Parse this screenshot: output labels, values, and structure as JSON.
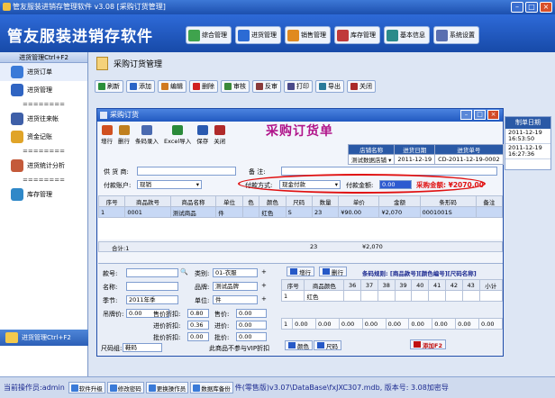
{
  "window": {
    "title": "管友服装进销存管理软件 v3.08 [采购订货管理]"
  },
  "banner": {
    "logo": "管友服装进销存软件"
  },
  "topnav": [
    {
      "label": "综合管理",
      "icon": "overview-icon",
      "color": "#3fa34d"
    },
    {
      "label": "进货管理",
      "icon": "purchase-icon",
      "color": "#2c6bd4"
    },
    {
      "label": "销售管理",
      "icon": "sales-icon",
      "color": "#e08a20"
    },
    {
      "label": "库存管理",
      "icon": "inventory-icon",
      "color": "#c03a3a"
    },
    {
      "label": "基本信息",
      "icon": "info-icon",
      "color": "#2a8a8a"
    },
    {
      "label": "系统设置",
      "icon": "settings-icon",
      "color": "#5a6fb0"
    }
  ],
  "sidebar": {
    "header": "进货管理Ctrl+F2",
    "items": [
      {
        "label": "进货订单",
        "icon": "order-icon",
        "color": "#3a7ad8",
        "type": "item"
      },
      {
        "label": "进货管理",
        "icon": "purchase-doc-icon",
        "color": "#2f64c2",
        "type": "item"
      },
      {
        "label": "========",
        "type": "dash"
      },
      {
        "label": "进货往来帐",
        "icon": "account-icon",
        "color": "#3e5fa8",
        "type": "item"
      },
      {
        "label": "资金记账",
        "icon": "coins-icon",
        "color": "#e0a428",
        "type": "item"
      },
      {
        "label": "========",
        "type": "dash"
      },
      {
        "label": "进货统计分析",
        "icon": "stats-icon",
        "color": "#c45a3a",
        "type": "item"
      },
      {
        "label": "========",
        "type": "dash"
      },
      {
        "label": "库存管理",
        "icon": "stock-icon",
        "color": "#2f88c8",
        "type": "item"
      }
    ],
    "footer": "进货管理Ctrl+F2"
  },
  "page": {
    "title": "采购订货管理"
  },
  "toolbar": [
    {
      "label": "刷新",
      "icon": "refresh-icon",
      "color": "#2a8f3a"
    },
    {
      "label": "添加",
      "icon": "add-icon",
      "color": "#2a64c6"
    },
    {
      "label": "编辑",
      "icon": "edit-icon",
      "color": "#d07a20"
    },
    {
      "label": "删除",
      "icon": "delete-icon",
      "color": "#d02020"
    },
    {
      "label": "审核",
      "icon": "approve-icon",
      "color": "#3a8a3a"
    },
    {
      "label": "反审",
      "icon": "unapprove-icon",
      "color": "#8a3a3a"
    },
    {
      "label": "打印",
      "icon": "print-icon",
      "color": "#4a4a8a"
    },
    {
      "label": "导出",
      "icon": "export-icon",
      "color": "#2a7a9a"
    },
    {
      "label": "关闭",
      "icon": "close-page-icon",
      "color": "#aa2a2a"
    }
  ],
  "bglist": {
    "header": "制单日期",
    "rows": [
      "2011-12-19 16:53:50",
      "2011-12-19 16:27:36"
    ]
  },
  "dialog": {
    "title": "采购订货",
    "toolbar": [
      {
        "label": "增行",
        "icon": "add-row-icon",
        "color": "#d05020"
      },
      {
        "label": "删行",
        "icon": "delete-row-icon",
        "color": "#c08020"
      },
      {
        "label": "条码录入",
        "icon": "barcode-icon",
        "color": "#4a6ab0"
      },
      {
        "label": "Excel导入",
        "icon": "excel-icon",
        "color": "#2a8a3a"
      },
      {
        "label": "保存",
        "icon": "save-icon",
        "color": "#2a5ab0"
      },
      {
        "label": "关闭",
        "icon": "close-icon",
        "color": "#b02a2a"
      }
    ],
    "big_title": "采购订货单",
    "header_table": {
      "cols": [
        "店铺名称",
        "进货日期",
        "进货单号"
      ],
      "values": [
        "测试数据店铺",
        "2011-12-19",
        "CD-2011-12-19-0002"
      ]
    },
    "supplier_label": "供 货 商:",
    "remark_label": "备  注:",
    "account_label": "付款账户:",
    "account_value": "现销",
    "paymethod_label": "付款方式:",
    "paymethod_value": "现金付款",
    "payamount_label": "付款金额:",
    "payamount_value": "0.00",
    "purchase_total": "采购金额: ¥2070.00",
    "grid": {
      "headers": [
        "序号",
        "商品款号",
        "商品名称",
        "单位",
        "色",
        "颜色",
        "尺码",
        "数量",
        "单价",
        "金额",
        "条形码",
        "备注"
      ],
      "rows": [
        [
          "1",
          "0001",
          "测试商品",
          "件",
          "",
          "红色",
          "S",
          "23",
          "¥90.00",
          "¥2,070",
          "0001001S",
          ""
        ]
      ],
      "sum_label": "合计:1",
      "sum_qty": "23",
      "sum_amount": "¥2,070"
    },
    "lower": {
      "fields": [
        {
          "label": "款号:",
          "value": ""
        },
        {
          "label": "名称:",
          "value": ""
        },
        {
          "label": "季节:",
          "value": "2011年季"
        },
        {
          "label": "吊牌价:",
          "value": "0.00"
        }
      ],
      "fields2": [
        {
          "label": "类别:",
          "value": "01-衣服"
        },
        {
          "label": "品牌:",
          "value": "测试品牌"
        },
        {
          "label": "单位:",
          "value": "件"
        }
      ],
      "discounts": [
        {
          "label": "售价折扣:",
          "value": "0.80",
          "label2": "售价:",
          "value2": "0.00"
        },
        {
          "label": "进价折扣:",
          "value": "0.36",
          "label2": "进价:",
          "value2": "0.00"
        },
        {
          "label": "批价折扣:",
          "value": "0.00",
          "label2": "批价:",
          "value2": "0.00"
        }
      ],
      "size_group_label": "尺码组:",
      "size_group_value": "鞋码",
      "vip_check": "此商品不参与VIP折扣",
      "add_color": "颜色",
      "add_size": "尺码",
      "add_row": "增行",
      "del_row": "删行",
      "rule_text": "条码规则: [商品款号][颜色编号][尺码名称]",
      "size_headers": [
        "序号",
        "商品颜色",
        "36",
        "37",
        "38",
        "39",
        "40",
        "41",
        "42",
        "43",
        "小计"
      ],
      "size_row": [
        "1",
        "红色",
        "",
        "",
        "",
        "",
        "",
        "",
        "",
        "",
        ""
      ],
      "size_total": [
        "1",
        "0.00",
        "0.00",
        "0.00",
        "0.00",
        "0.00",
        "0.00",
        "0.00",
        "0.00",
        "0.00"
      ],
      "add_f2": "添加F2"
    }
  },
  "status": {
    "operator_label": "当前操作员:",
    "operator": "admin",
    "buttons": [
      "软件升级",
      "修改密码",
      "更换操作员",
      "数据库备份"
    ],
    "path": "件(零售版)v3.07\\DataBase\\fxJXC307.mdb, 版本号: 3.08加密导"
  }
}
